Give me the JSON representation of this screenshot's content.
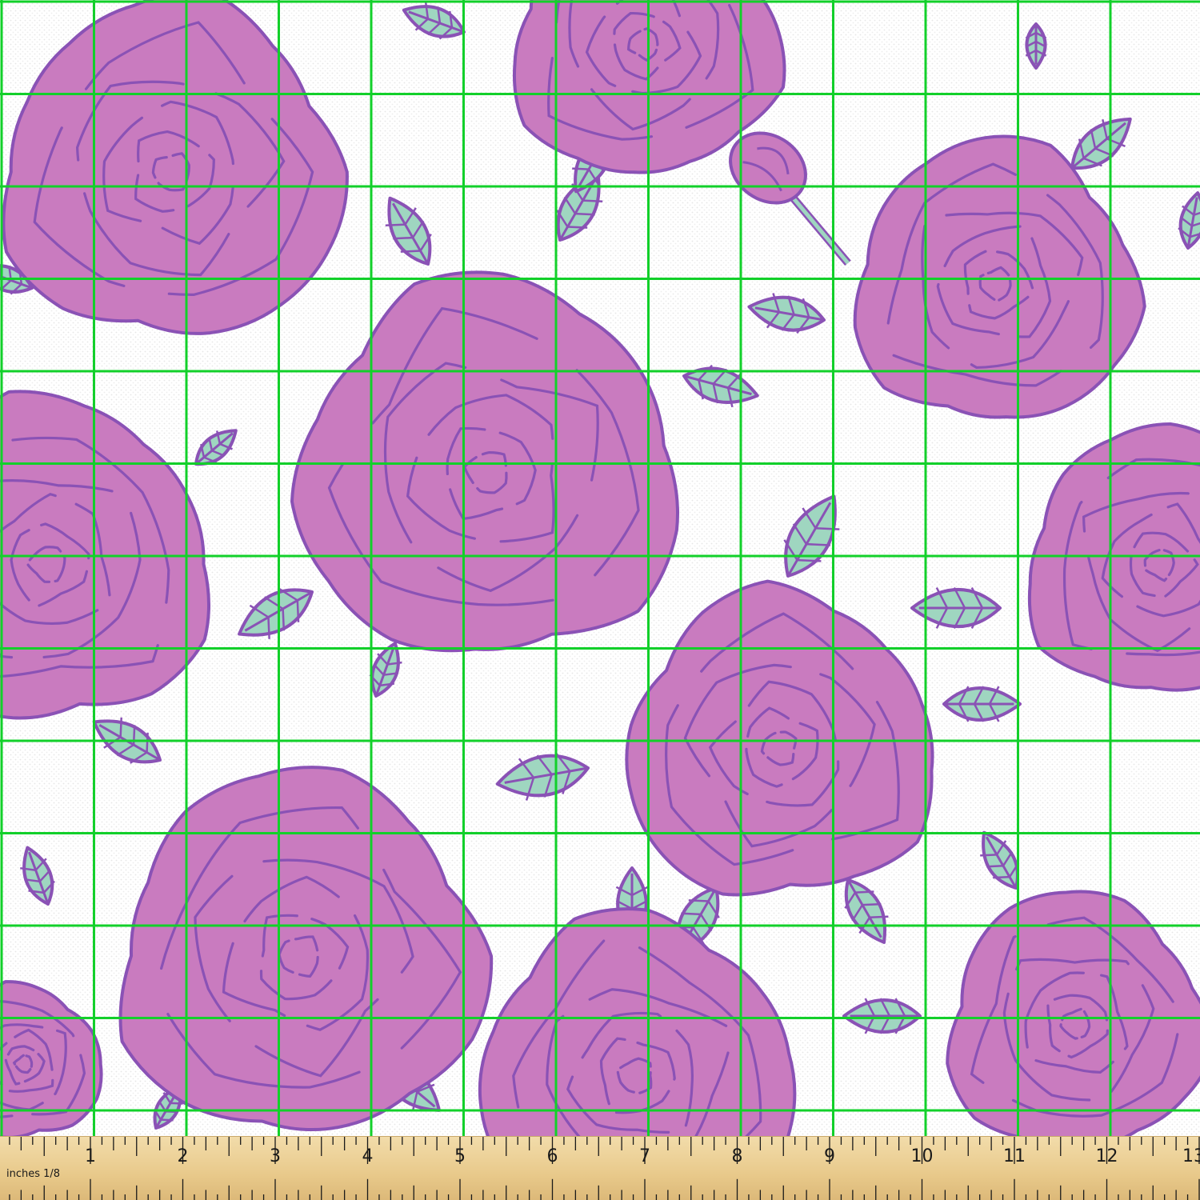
{
  "colors": {
    "background": "#ffffff",
    "petal_fill": "#c97bbf",
    "petal_stroke": "#8a52b5",
    "leaf_fill": "#9fd6c0",
    "grid_line": "#12d02a",
    "ruler_wood": "#e8c98a",
    "ruler_ink": "#1a1a1a"
  },
  "pattern": {
    "motif": "rose-icon",
    "leaf": "leaf-icon",
    "bud": "rosebud-icon"
  },
  "ruler": {
    "unit_label": "inches 1/8",
    "numbers": [
      "1",
      "2",
      "3",
      "4",
      "5",
      "6",
      "7",
      "8",
      "9",
      "10",
      "11",
      "12",
      "13"
    ]
  }
}
